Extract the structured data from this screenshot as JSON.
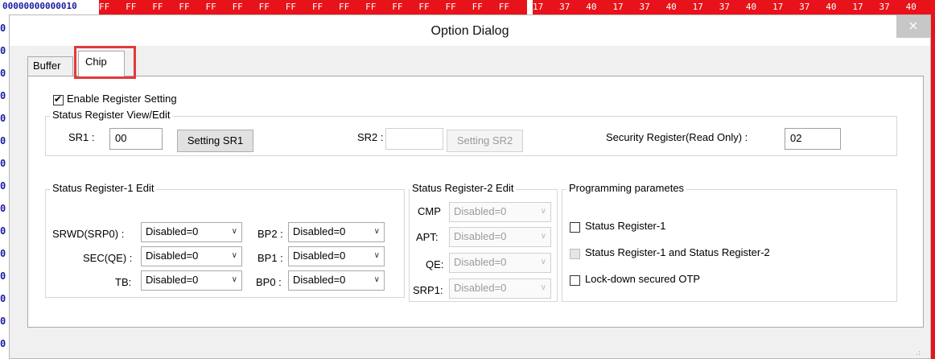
{
  "background": {
    "address": "00000000000010",
    "hex_bytes": "FF   FF   FF   FF   FF   FF   FF   FF   FF   FF   FF   FF   FF   FF   FF   FF",
    "ascii_bytes": "17   37   40   17   37   40   17   37   40   17   37   40   17   37   40",
    "gutter_char": "0"
  },
  "dialog": {
    "title": "Option Dialog",
    "close_glyph": "×"
  },
  "tabs": [
    {
      "label": "Buffer",
      "active": false
    },
    {
      "label": "Chip",
      "active": true
    }
  ],
  "chip": {
    "enable_register_setting": {
      "label": "Enable Register Setting",
      "checked": true
    },
    "status_view": {
      "legend": "Status Register View/Edit",
      "sr1_label": "SR1 :",
      "sr1_value": "00",
      "setting_sr1": "Setting SR1",
      "sr2_label": "SR2 :",
      "sr2_value": "",
      "setting_sr2": "Setting SR2",
      "security_label": "Security Register(Read Only) :",
      "security_value": "02"
    },
    "sr1_edit": {
      "legend": "Status Register-1 Edit",
      "fields": [
        {
          "label": "SRWD(SRP0) :",
          "value": "Disabled=0"
        },
        {
          "label": "SEC(QE) :",
          "value": "Disabled=0"
        },
        {
          "label": "TB:",
          "value": "Disabled=0"
        },
        {
          "label": "BP2 :",
          "value": "Disabled=0"
        },
        {
          "label": "BP1 :",
          "value": "Disabled=0"
        },
        {
          "label": "BP0 :",
          "value": "Disabled=0"
        }
      ]
    },
    "sr2_edit": {
      "legend": "Status Register-2 Edit",
      "fields": [
        {
          "label": "CMP",
          "value": "Disabled=0"
        },
        {
          "label": "APT:",
          "value": "Disabled=0"
        },
        {
          "label": "QE:",
          "value": "Disabled=0"
        },
        {
          "label": "SRP1:",
          "value": "Disabled=0"
        }
      ]
    },
    "programming": {
      "legend": "Programming parametes",
      "options": [
        {
          "label": "Status Register-1",
          "checked": false,
          "enabled": true
        },
        {
          "label": "Status Register-1 and Status Register-2",
          "checked": false,
          "enabled": false
        },
        {
          "label": "Lock-down secured OTP",
          "checked": false,
          "enabled": true
        }
      ]
    }
  },
  "colors": {
    "highlight": "#e23a3a",
    "hex_bar": "#e8121a",
    "address_blue": "#1a1aa8"
  }
}
